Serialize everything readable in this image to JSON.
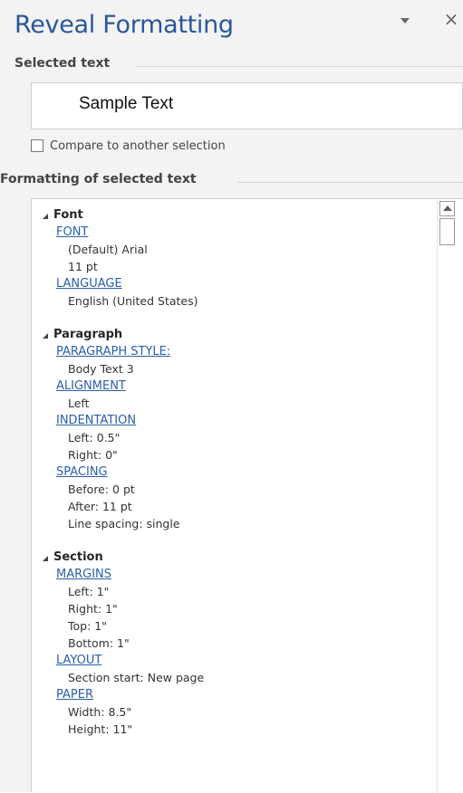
{
  "pane": {
    "title": "Reveal Formatting",
    "menu_icon": "chevron-down-icon",
    "close_glyph": "×"
  },
  "selected_text": {
    "heading": "Selected text",
    "sample": "Sample Text"
  },
  "compare": {
    "label": "Compare to another selection",
    "checked": false
  },
  "formatting": {
    "heading": "Formatting of selected text",
    "groups": [
      {
        "name": "Font",
        "entries": [
          {
            "link": "FONT",
            "values": [
              "(Default) Arial",
              "11 pt"
            ]
          },
          {
            "link": "LANGUAGE",
            "values": [
              "English (United States)"
            ]
          }
        ]
      },
      {
        "name": "Paragraph",
        "entries": [
          {
            "link": "PARAGRAPH STYLE:",
            "values": [
              "Body Text 3"
            ]
          },
          {
            "link": "ALIGNMENT",
            "values": [
              "Left"
            ]
          },
          {
            "link": "INDENTATION",
            "values": [
              "Left:  0.5\"",
              "Right:  0\""
            ]
          },
          {
            "link": "SPACING",
            "values": [
              "Before:  0 pt",
              "After:  11 pt",
              "Line spacing:  single"
            ]
          }
        ]
      },
      {
        "name": "Section",
        "entries": [
          {
            "link": "MARGINS",
            "values": [
              "Left:  1\"",
              "Right:  1\"",
              "Top:  1\"",
              "Bottom:  1\""
            ]
          },
          {
            "link": "LAYOUT",
            "values": [
              "Section start: New page"
            ]
          },
          {
            "link": "PAPER",
            "values": [
              "Width:  8.5\"",
              "Height:  11\""
            ]
          }
        ]
      }
    ]
  }
}
